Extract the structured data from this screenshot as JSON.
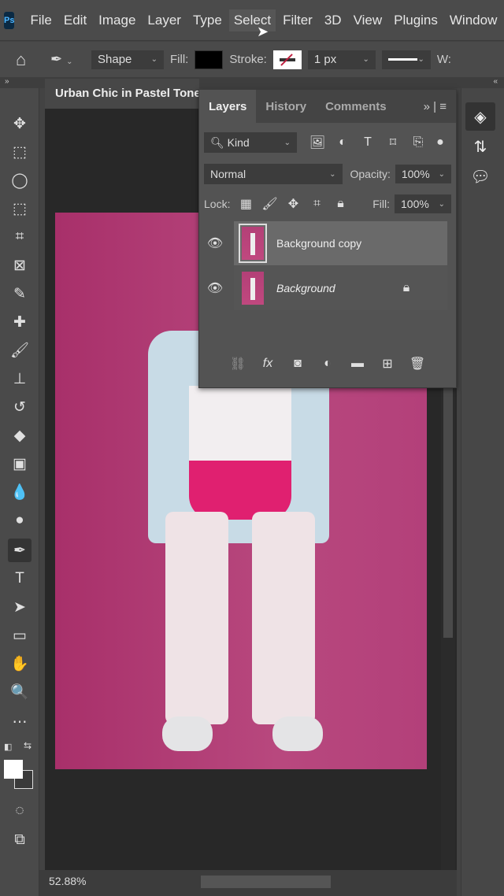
{
  "app": {
    "logo": "Ps"
  },
  "menu": [
    "File",
    "Edit",
    "Image",
    "Layer",
    "Type",
    "Select",
    "Filter",
    "3D",
    "View",
    "Plugins",
    "Window"
  ],
  "options": {
    "mode": "Shape",
    "fill_label": "Fill:",
    "fill_color": "#000000",
    "stroke_label": "Stroke:",
    "stroke_width": "1 px",
    "w_label": "W:"
  },
  "document": {
    "title": "Urban Chic in Pastel Tones",
    "zoom": "52.88%",
    "bg_color": "#b03a73"
  },
  "layers_panel": {
    "tabs": [
      "Layers",
      "History",
      "Comments"
    ],
    "filter_kind": "Kind",
    "blend_mode": "Normal",
    "opacity_label": "Opacity:",
    "opacity": "100%",
    "lock_label": "Lock:",
    "fill_label": "Fill:",
    "fill": "100%",
    "layers": [
      {
        "name": "Background copy",
        "selected": true,
        "visible": true
      },
      {
        "name": "Background",
        "selected": false,
        "visible": true,
        "locked": true
      }
    ]
  },
  "collapse": {
    "left": "»",
    "right": "«"
  }
}
